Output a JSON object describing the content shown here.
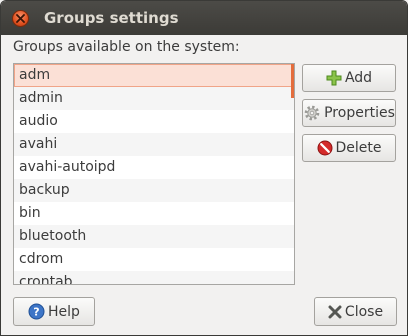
{
  "window": {
    "title": "Groups settings"
  },
  "caption": "Groups available on the system:",
  "groups": [
    "adm",
    "admin",
    "audio",
    "avahi",
    "avahi-autoipd",
    "backup",
    "bin",
    "bluetooth",
    "cdrom",
    "crontab"
  ],
  "selected_index": 0,
  "buttons": {
    "add": "Add",
    "properties": "Properties",
    "delete": "Delete",
    "help": "Help",
    "close": "Close"
  },
  "icons": {
    "window_close": "close-icon",
    "add": "plus-icon",
    "properties": "gear-icon",
    "delete": "no-entry-icon",
    "help": "help-icon",
    "close": "x-icon"
  },
  "colors": {
    "selection_bg": "#fbe0d6",
    "accent": "#e46d3d"
  }
}
